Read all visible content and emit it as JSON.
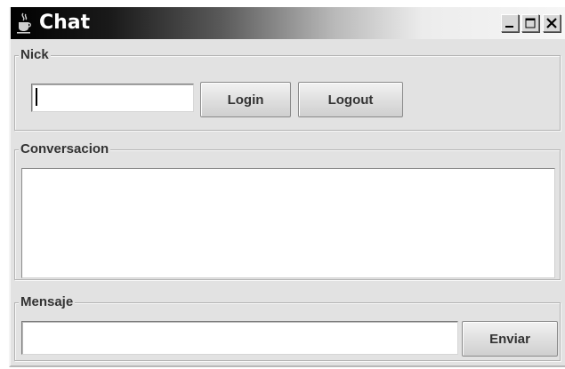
{
  "window": {
    "title": "Chat",
    "icon": "java-cup-icon",
    "controls": {
      "minimize": "minimize-icon",
      "maximize": "maximize-icon",
      "close": "close-icon"
    }
  },
  "nick": {
    "legend": "Nick",
    "input_value": "",
    "login_label": "Login",
    "logout_label": "Logout"
  },
  "conversation": {
    "legend": "Conversacion",
    "content": ""
  },
  "message": {
    "legend": "Mensaje",
    "input_value": "",
    "send_label": "Enviar"
  },
  "colors": {
    "window_background": "#e2e2e2",
    "titlebar_start": "#000000",
    "titlebar_end": "#f6f6f6",
    "title_text": "#ffffff"
  }
}
